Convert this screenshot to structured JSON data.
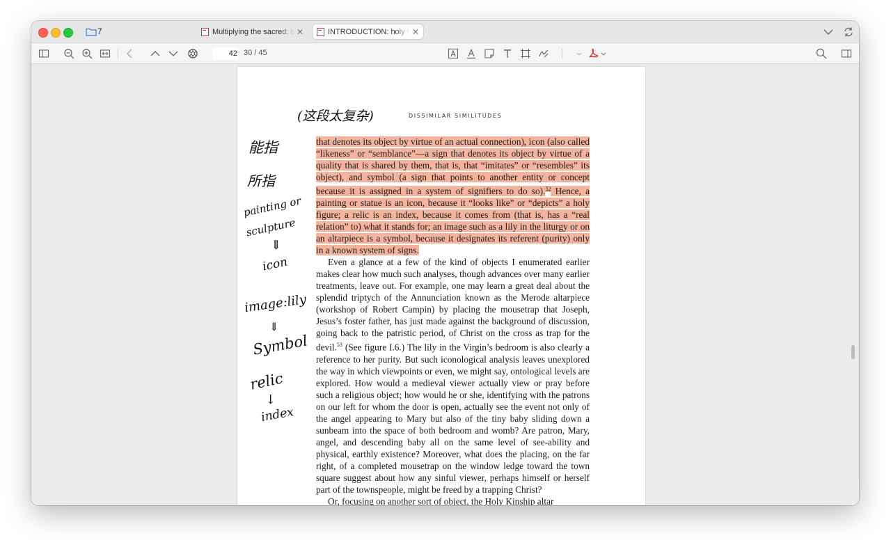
{
  "window": {
    "folder_count": "7",
    "tabs": [
      {
        "label": "Multiplying the sacred: the",
        "active": false
      },
      {
        "label": "INTRODUCTION: holy things",
        "active": true
      }
    ]
  },
  "toolbar": {
    "page_input": "42",
    "page_total": "30 / 45",
    "icons": [
      "sidebar-icon",
      "zoom-out-icon",
      "zoom-in-icon",
      "fit-width-icon",
      "back-icon",
      "previous-page-icon",
      "next-page-icon",
      "ai-assistant-icon",
      "text-box-icon",
      "underline-icon",
      "note-icon",
      "text-icon",
      "crop-icon",
      "signature-icon",
      "pdf-tools-icon",
      "search-icon",
      "inspector-icon"
    ]
  },
  "document": {
    "running_head": "DISSIMILAR SIMILITUDES",
    "highlighted_text": "that denotes its object by virtue of an actual connection), icon (also called “likeness” or “semblance”—a sign that denotes its object by virtue of a quality that is shared by them, that is, that “imitates” or “resembles” its object), and symbol (a sign that points to another entity or concept because it is assigned in a system of signifiers to do so).",
    "footnote_52": "52",
    "highlighted_text_2": " Hence, a painting or statue is an icon, because it “looks like” or “depicts” a holy figure; a relic is an index, because it comes from (that is, has a “real relation” to) what it stands for; an image such as a lily in the liturgy or on an altarpiece is a symbol, because it designates its referent (purity) only in a known system of signs.",
    "paragraph_part1": "Even a glance at a few of the kind of objects I enumerated earlier makes clear how much such analyses, though advances over many earlier treatments, leave out. For example, one may learn a great deal about the splendid triptych of the Annunciation known as the Merode altarpiece (workshop of Robert Campin) by placing the mousetrap that Joseph, Jesus’s foster father, has just made against the background of discussion, going back to the patristic period, of Christ on the cross as trap for the devil.",
    "footnote_53": "53",
    "paragraph_part2": " (See figure I.6.) The lily in the Virgin’s bedroom is also clearly a reference to her purity. But such iconological analysis leaves unexplored the way in which viewpoints or even, we might say, ontological levels are explored. How would a medieval viewer actually view or pray before such a religious object; how would he or she, identifying with the patrons on our left for whom the door is open, actually see the event not only of the angel appearing to Mary but also of the tiny baby sliding down a sunbeam into the space of both bedroom and womb? Are patron, Mary, angel, and descending baby all on the same level of see-ability and physical, earthly existence? Moreover, what does the placing, on the far right, of a completed mousetrap on the window ledge toward the town square suggest about how any sinful viewer, perhaps himself or herself part of the townspeople, might be freed by a trapping Christ?",
    "last_line_partial": "Or, focusing on another sort of object, the Holy Kinship altar"
  },
  "annotations": {
    "handwritten_top": "(这段太复杂)",
    "handwritten_1": "能指",
    "handwritten_2": "所指",
    "handwritten_3a": "painting or",
    "handwritten_3b": "sculpture",
    "arrow_1": "⇓",
    "handwritten_4": "icon",
    "handwritten_5": "image:lily",
    "arrow_2": "⇓",
    "handwritten_6": "Symbol",
    "handwritten_7": "relic",
    "arrow_3": "↓",
    "handwritten_8": "index"
  },
  "colors": {
    "highlight_orange": "#f4b39c",
    "highlight_green": "#bfe8e6",
    "pdf_red": "#d7342b"
  }
}
